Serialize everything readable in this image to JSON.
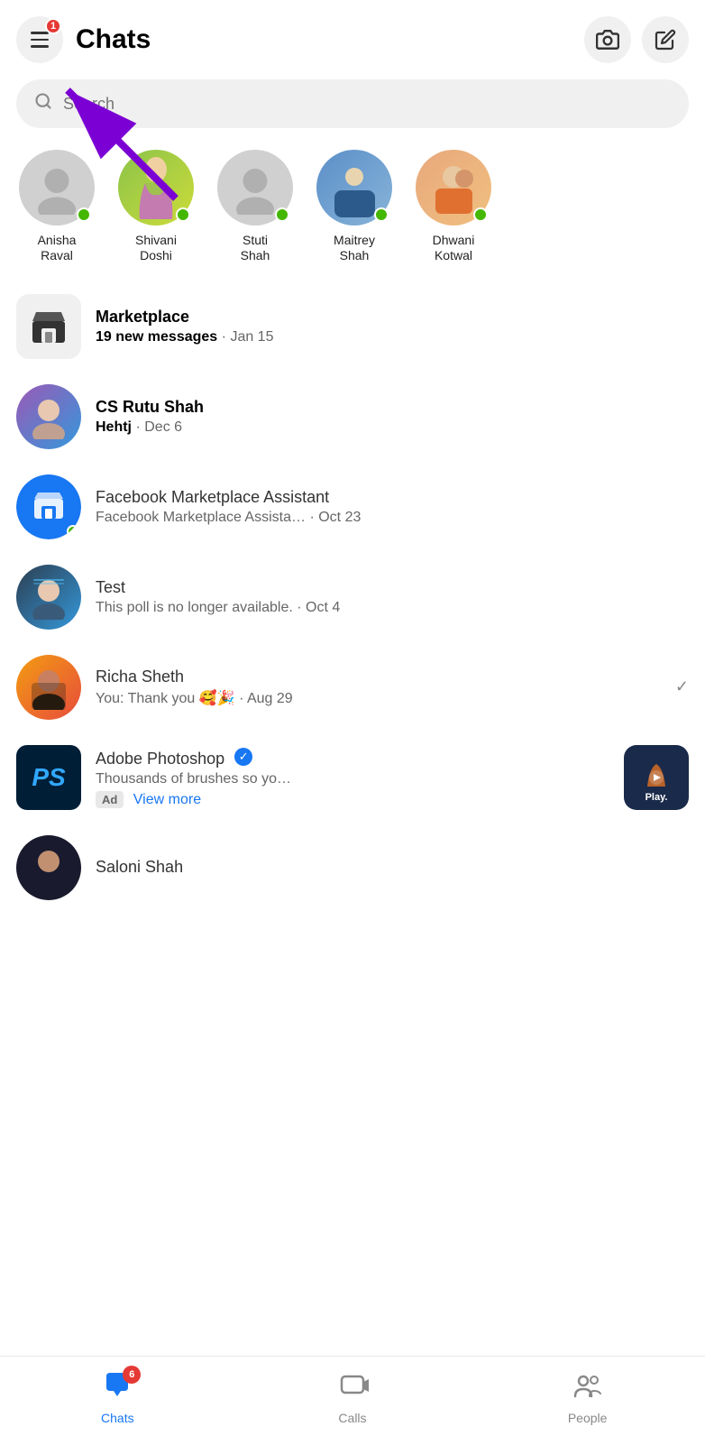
{
  "header": {
    "title": "Chats",
    "menu_badge": "1",
    "camera_label": "camera",
    "compose_label": "compose"
  },
  "search": {
    "placeholder": "Search"
  },
  "contacts": [
    {
      "id": "anisha",
      "name": "Anisha\nRaval",
      "online": true,
      "hasImage": false
    },
    {
      "id": "shivani",
      "name": "Shivani\nDoshi",
      "online": true,
      "hasImage": true
    },
    {
      "id": "stuti",
      "name": "Stuti\nShah",
      "online": true,
      "hasImage": false
    },
    {
      "id": "maitrey",
      "name": "Maitrey\nShah",
      "online": true,
      "hasImage": true
    },
    {
      "id": "dhwani",
      "name": "Dhwani\nKotwal",
      "online": true,
      "hasImage": true
    }
  ],
  "chats": [
    {
      "id": "marketplace",
      "name": "Marketplace",
      "preview": "19 new messages",
      "time": "Jan 15",
      "type": "marketplace",
      "bold_preview": true
    },
    {
      "id": "cs-rutu",
      "name": "CS Rutu Shah",
      "preview": "Hehtj",
      "time": "Dec 6",
      "type": "person",
      "bold_name": true,
      "bold_preview": true
    },
    {
      "id": "fb-marketplace-assistant",
      "name": "Facebook Marketplace Assistant",
      "preview": "Facebook Marketplace Assista…",
      "time": "Oct 23",
      "type": "fb-marketplace",
      "online": true
    },
    {
      "id": "test",
      "name": "Test",
      "preview": "This poll is no longer available.",
      "time": "Oct 4",
      "type": "person"
    },
    {
      "id": "richa",
      "name": "Richa Sheth",
      "preview": "You: Thank you 🥰🎉",
      "time": "Aug 29",
      "type": "person",
      "has_check": true
    },
    {
      "id": "adobe",
      "name": "Adobe Photoshop",
      "preview": "Thousands of brushes so yo…",
      "time": "",
      "type": "adobe",
      "verified": true,
      "is_ad": true,
      "ad_label": "Ad",
      "view_more": "View more"
    },
    {
      "id": "saloni",
      "name": "Saloni Shah",
      "preview": "",
      "time": "",
      "type": "person"
    }
  ],
  "bottom_nav": {
    "chats_label": "Chats",
    "calls_label": "Calls",
    "people_label": "People",
    "chats_badge": "6"
  },
  "arrow": {
    "visible": true
  }
}
